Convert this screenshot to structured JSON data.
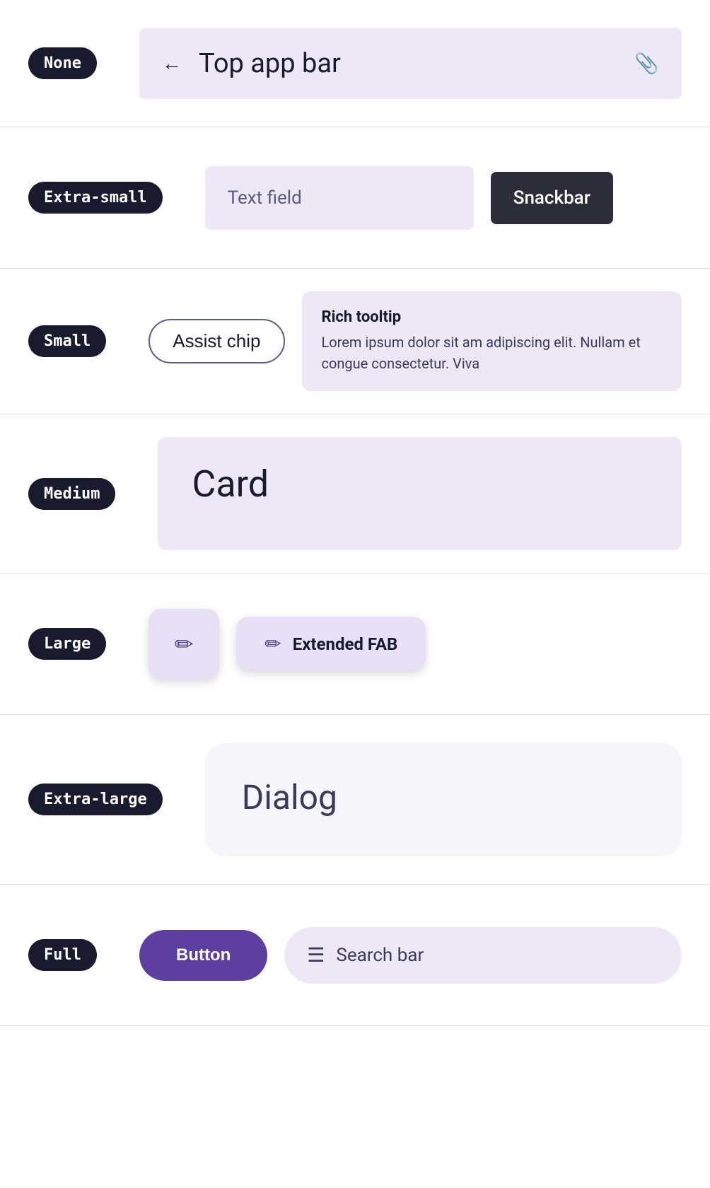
{
  "rows": [
    {
      "id": "none-row",
      "badge": "None",
      "topAppBar": {
        "backIcon": "←",
        "title": "Top app bar",
        "attachIcon": "📎"
      }
    },
    {
      "id": "extra-small-row",
      "badge": "Extra-small",
      "textField": {
        "placeholder": "Text field"
      },
      "snackbar": {
        "label": "Snackbar"
      }
    },
    {
      "id": "small-row",
      "badge": "Small",
      "assistChip": {
        "label": "Assist chip"
      },
      "richTooltip": {
        "title": "Rich tooltip",
        "body": "Lorem ipsum dolor sit am adipiscing elit. Nullam et congue consectetur. Viva"
      }
    },
    {
      "id": "medium-row",
      "badge": "Medium",
      "card": {
        "title": "Card"
      }
    },
    {
      "id": "large-row",
      "badge": "Large",
      "fab": {
        "icon": "✏"
      },
      "extendedFab": {
        "icon": "✏",
        "label": "Extended FAB"
      }
    },
    {
      "id": "extra-large-row",
      "badge": "Extra-large",
      "dialog": {
        "title": "Dialog"
      }
    },
    {
      "id": "full-row",
      "badge": "Full",
      "button": {
        "label": "Button"
      },
      "searchBar": {
        "menuIcon": "☰",
        "label": "Search bar"
      }
    }
  ]
}
